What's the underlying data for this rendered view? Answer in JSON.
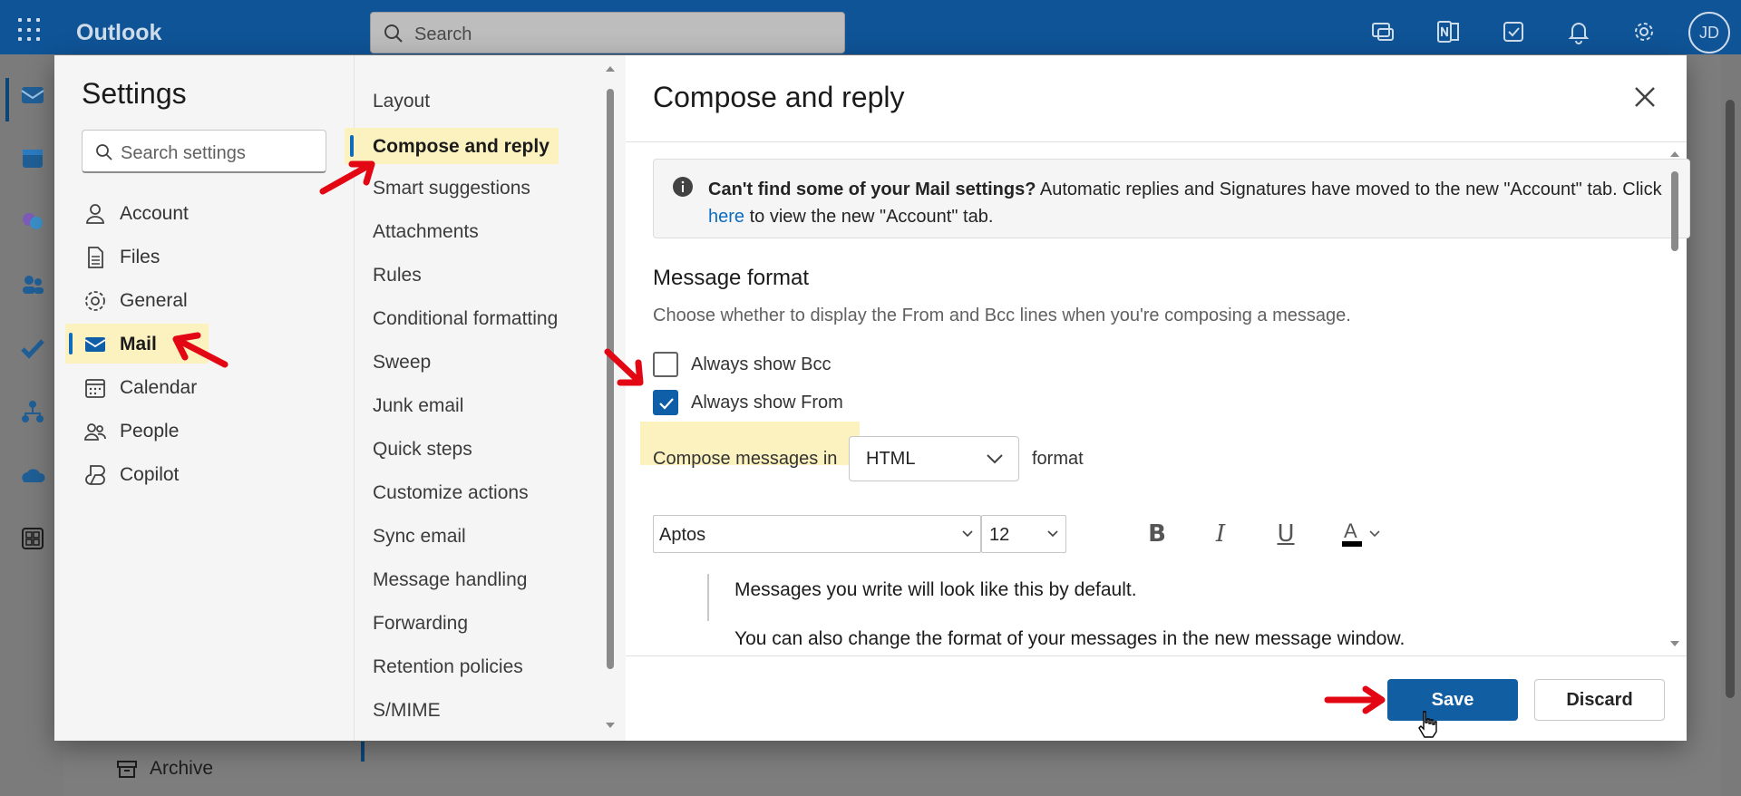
{
  "app": {
    "name": "Outlook",
    "search_placeholder": "Search",
    "avatar_initials": "JD"
  },
  "background": {
    "archive_label": "Archive"
  },
  "settings": {
    "title": "Settings",
    "search_placeholder": "Search settings",
    "categories": [
      {
        "label": "Account",
        "icon": "person-icon"
      },
      {
        "label": "Files",
        "icon": "document-icon"
      },
      {
        "label": "General",
        "icon": "gear-icon"
      },
      {
        "label": "Mail",
        "icon": "mail-icon",
        "selected": true
      },
      {
        "label": "Calendar",
        "icon": "calendar-icon"
      },
      {
        "label": "People",
        "icon": "people-icon"
      },
      {
        "label": "Copilot",
        "icon": "copilot-icon"
      }
    ],
    "mail_sections": [
      {
        "label": "Layout"
      },
      {
        "label": "Compose and reply",
        "selected": true
      },
      {
        "label": "Smart suggestions"
      },
      {
        "label": "Attachments"
      },
      {
        "label": "Rules"
      },
      {
        "label": "Conditional formatting"
      },
      {
        "label": "Sweep"
      },
      {
        "label": "Junk email"
      },
      {
        "label": "Quick steps"
      },
      {
        "label": "Customize actions"
      },
      {
        "label": "Sync email"
      },
      {
        "label": "Message handling"
      },
      {
        "label": "Forwarding"
      },
      {
        "label": "Retention policies"
      },
      {
        "label": "S/MIME"
      }
    ]
  },
  "panel": {
    "title": "Compose and reply",
    "info": {
      "bold": "Can't find some of your Mail settings?",
      "text1": " Automatic replies and Signatures have moved to the new \"Account\" tab. Click ",
      "link": "here",
      "text2": " to view the new \"Account\" tab."
    },
    "message_format": {
      "title": "Message format",
      "description": "Choose whether to display the From and Bcc lines when you're composing a message.",
      "always_show_bcc": {
        "label": "Always show Bcc",
        "checked": false
      },
      "always_show_from": {
        "label": "Always show From",
        "checked": true
      },
      "compose_prefix": "Compose messages in",
      "compose_format": "HTML",
      "compose_suffix": "format"
    },
    "toolbar": {
      "font": "Aptos",
      "size": "12",
      "bold": "B",
      "italic": "I",
      "underline": "U",
      "color_letter": "A"
    },
    "preview": {
      "line1": "Messages you write will look like this by default.",
      "line2": "You can also change the format of your messages in the new message window."
    },
    "buttons": {
      "save": "Save",
      "discard": "Discard"
    }
  },
  "colors": {
    "accent": "#0f6cbd",
    "topbar": "#0f5497",
    "highlight": "#fbf2bf",
    "annotation_arrow": "#e30613"
  }
}
